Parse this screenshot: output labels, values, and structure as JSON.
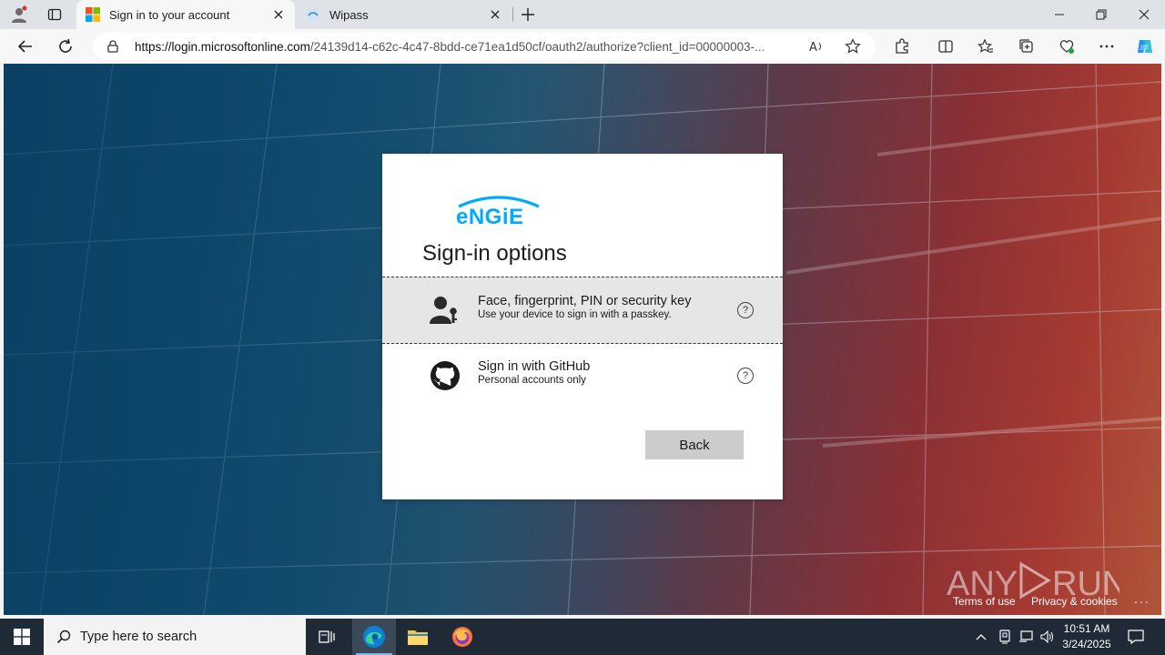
{
  "browser": {
    "tabs": [
      {
        "title": "Sign in to your account",
        "active": true
      },
      {
        "title": "Wipass",
        "active": false
      }
    ],
    "address": {
      "host": "https://login.microsoftonline.com",
      "path": "/24139d14-c62c-4c47-8bdd-ce71ea1d50cf/oauth2/authorize?client_id=00000003-..."
    }
  },
  "card": {
    "brand": "engie",
    "title": "Sign-in options",
    "options": [
      {
        "title": "Face, fingerprint, PIN or security key",
        "subtitle": "Use your device to sign in with a passkey.",
        "help": "?"
      },
      {
        "title": "Sign in with GitHub",
        "subtitle": "Personal accounts only",
        "help": "?"
      }
    ],
    "back_label": "Back"
  },
  "footer": {
    "terms": "Terms of use",
    "privacy": "Privacy & cookies",
    "more": "..."
  },
  "watermark": "ANY RUN",
  "taskbar": {
    "search_placeholder": "Type here to search",
    "time": "10:51 AM",
    "date": "3/24/2025"
  },
  "colors": {
    "engie_blue": "#00aaff",
    "taskbar": "#1f2a36",
    "accent": "#0078d4"
  }
}
